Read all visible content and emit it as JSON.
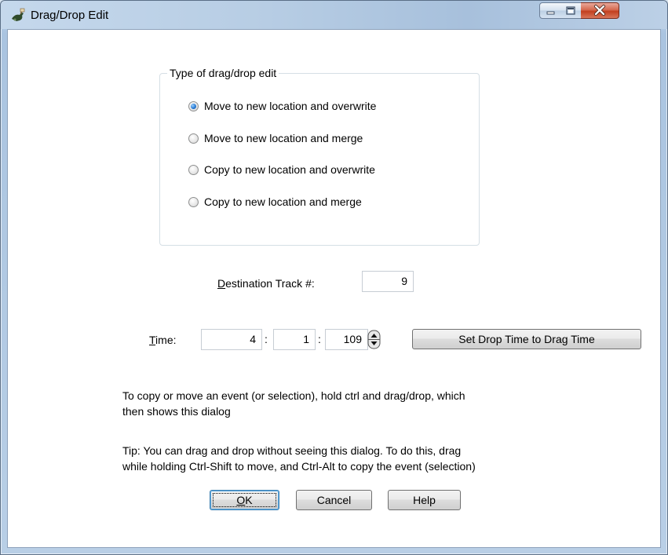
{
  "window": {
    "title": "Drag/Drop Edit",
    "icon": "app-icon"
  },
  "group": {
    "legend": "Type of drag/drop edit",
    "options": [
      {
        "label": "Move to new location and overwrite",
        "checked": true
      },
      {
        "label": "Move to new location and merge",
        "checked": false
      },
      {
        "label": "Copy to new location and overwrite",
        "checked": false
      },
      {
        "label": "Copy to new location and merge",
        "checked": false
      }
    ]
  },
  "destination": {
    "label_accel": "D",
    "label_rest": "estination Track #:",
    "value": "9"
  },
  "time": {
    "label_accel": "T",
    "label_rest": "ime:",
    "sep1": ":",
    "sep2": ":",
    "measure": "4",
    "beat": "1",
    "tick": "109",
    "set_button": "Set Drop Time to Drag Time"
  },
  "info": {
    "line1": "To copy or move an event (or selection), hold ctrl and drag/drop, which",
    "line2": "then shows this dialog",
    "tip1": "Tip: You can drag and drop without seeing this dialog. To do this, drag",
    "tip2": "while holding Ctrl-Shift to move, and Ctrl-Alt to copy the event (selection)"
  },
  "buttons": {
    "ok_accel": "O",
    "ok_rest": "K",
    "cancel": "Cancel",
    "help": "Help"
  }
}
